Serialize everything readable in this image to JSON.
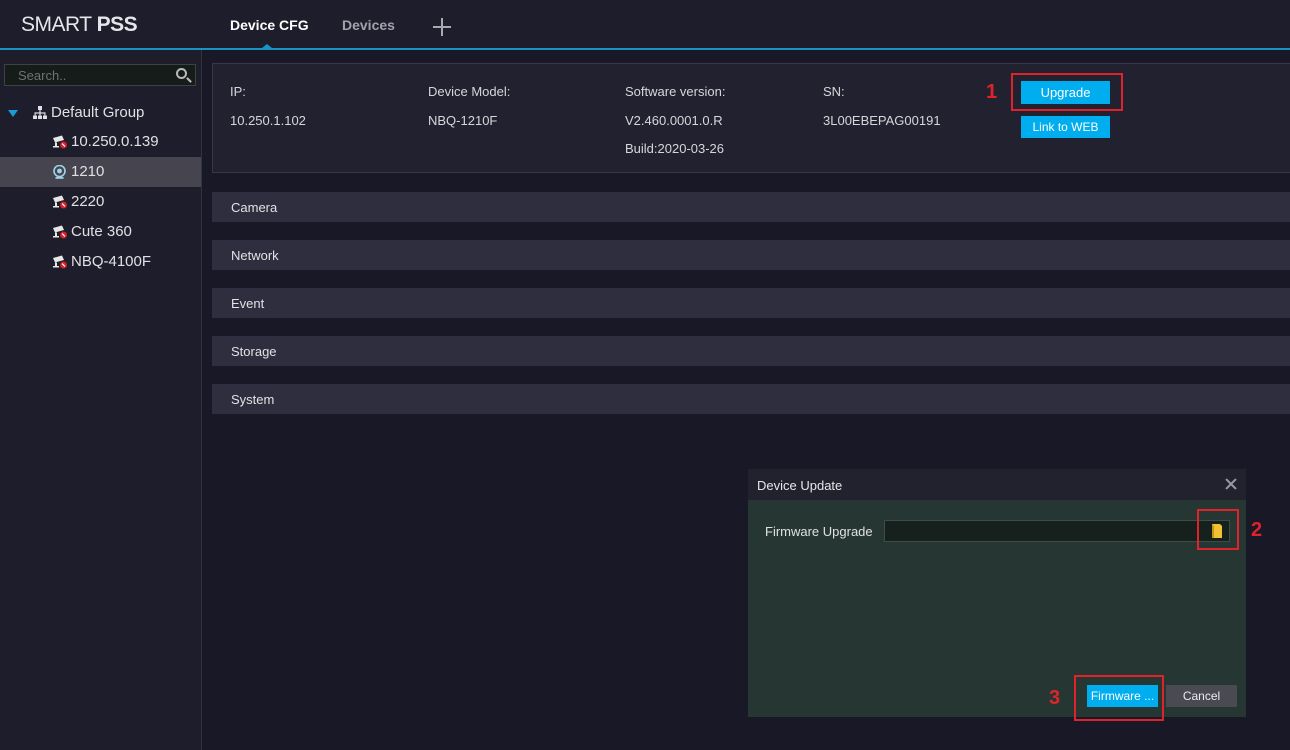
{
  "app": {
    "logo_light": "SMART ",
    "logo_bold": "PSS"
  },
  "tabs": [
    {
      "label": "Device CFG",
      "active": true
    },
    {
      "label": "Devices",
      "active": false
    }
  ],
  "sidebar": {
    "search_placeholder": "Search..",
    "group": "Default Group",
    "devices": [
      {
        "label": "10.250.0.139",
        "icon": "camera-offline-icon",
        "selected": false
      },
      {
        "label": "1210",
        "icon": "camera-online-icon",
        "selected": true
      },
      {
        "label": "2220",
        "icon": "camera-offline-icon",
        "selected": false
      },
      {
        "label": "Cute 360",
        "icon": "camera-offline-icon",
        "selected": false
      },
      {
        "label": "NBQ-4100F",
        "icon": "camera-offline-icon",
        "selected": false
      }
    ]
  },
  "device_info": {
    "ip_label": "IP:",
    "ip": "10.250.1.102",
    "model_label": "Device Model:",
    "model": "NBQ-1210F",
    "software_label": "Software version:",
    "software": "V2.460.0001.0.R",
    "build": "Build:2020-03-26",
    "sn_label": "SN:",
    "sn": "3L00EBEPAG00191",
    "upgrade_button": "Upgrade",
    "web_button": "Link to WEB"
  },
  "sections": [
    "Camera",
    "Network",
    "Event",
    "Storage",
    "System"
  ],
  "dialog": {
    "title": "Device Update",
    "firmware_label": "Firmware Upgrade",
    "firmware_value": "",
    "firmware_button": "Firmware ...",
    "cancel_button": "Cancel"
  },
  "annotations": {
    "step1": "1",
    "step2": "2",
    "step3": "3",
    "color": "#e0232a"
  },
  "colors": {
    "accent": "#00adee",
    "background": "#191826",
    "dialog_body": "#263733"
  }
}
